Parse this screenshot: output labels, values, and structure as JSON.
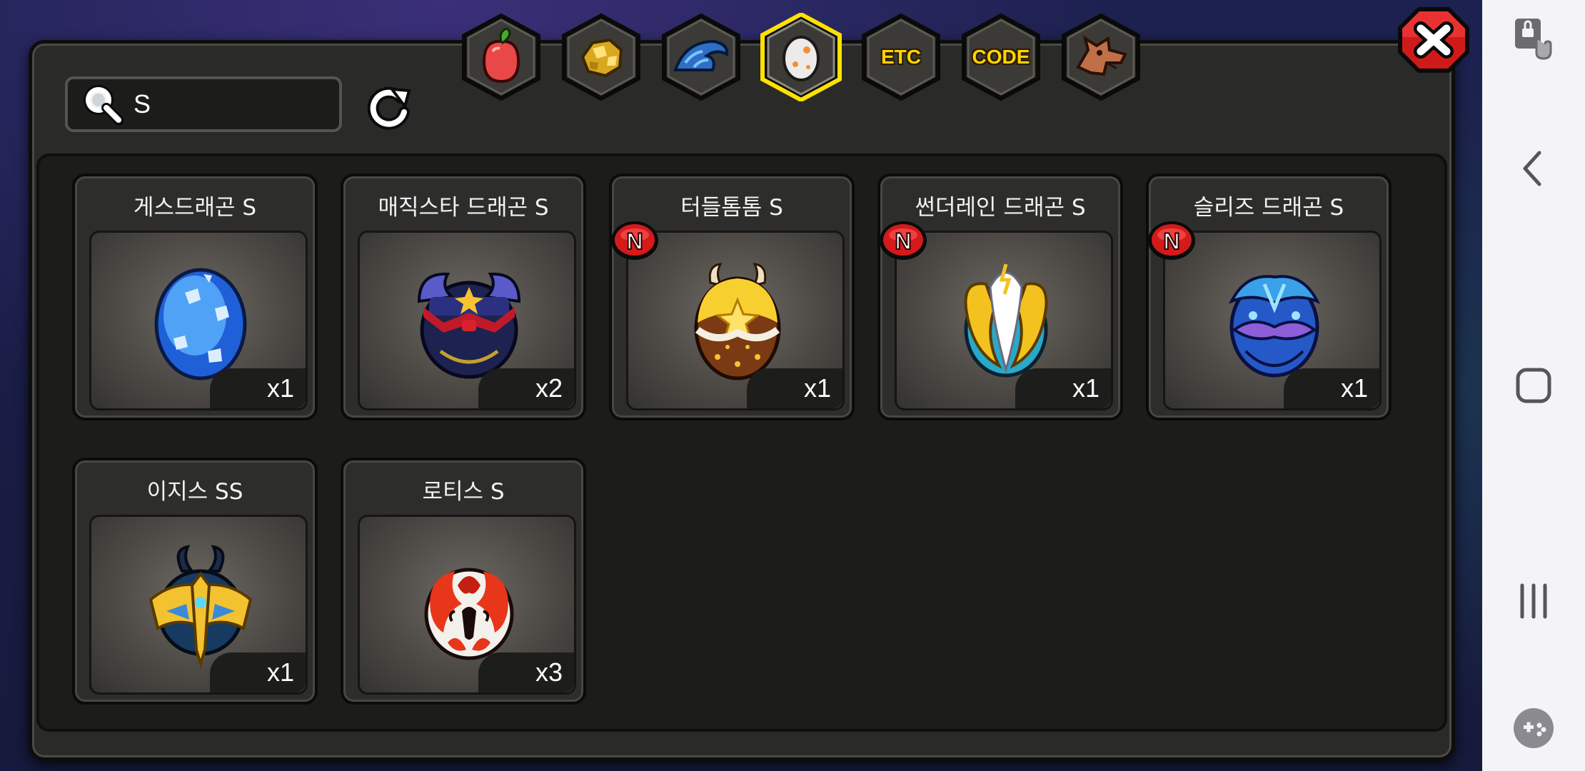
{
  "search": {
    "value": "S"
  },
  "tabs": [
    {
      "id": "fruit",
      "icon": "fruit-icon",
      "label": "",
      "selected": false
    },
    {
      "id": "gold",
      "icon": "gold-ore-icon",
      "label": "",
      "selected": false
    },
    {
      "id": "scale",
      "icon": "dragon-scale-icon",
      "label": "",
      "selected": false
    },
    {
      "id": "egg",
      "icon": "egg-icon",
      "label": "",
      "selected": true
    },
    {
      "id": "etc",
      "icon": "",
      "label": "ETC",
      "selected": false
    },
    {
      "id": "code",
      "icon": "",
      "label": "CODE",
      "selected": false
    },
    {
      "id": "dragon",
      "icon": "dragon-head-icon",
      "label": "",
      "selected": false
    }
  ],
  "items": [
    {
      "name": "게스드래곤 S",
      "qty": "x1",
      "is_new": false,
      "icon": "blue-crystal-egg-icon"
    },
    {
      "name": "매직스타 드래곤 S",
      "qty": "x2",
      "is_new": false,
      "icon": "magic-star-egg-icon"
    },
    {
      "name": "터들톰톰 S",
      "qty": "x1",
      "is_new": true,
      "icon": "golden-star-egg-icon"
    },
    {
      "name": "썬더레인 드래곤 S",
      "qty": "x1",
      "is_new": true,
      "icon": "thunder-crest-egg-icon"
    },
    {
      "name": "슬리즈 드래곤 S",
      "qty": "x1",
      "is_new": true,
      "icon": "blue-armored-egg-icon"
    },
    {
      "name": "이지스 SS",
      "qty": "x1",
      "is_new": false,
      "icon": "aegis-crest-egg-icon"
    },
    {
      "name": "로티스 S",
      "qty": "x3",
      "is_new": false,
      "icon": "red-flame-egg-icon"
    }
  ],
  "new_badge_label": "N",
  "colors": {
    "panel": "#2a2a28",
    "grid": "#1c1c1b",
    "accent_selected": "#ffe100",
    "new_badge": "#d41a1a",
    "close_button": "#d01a1a"
  }
}
